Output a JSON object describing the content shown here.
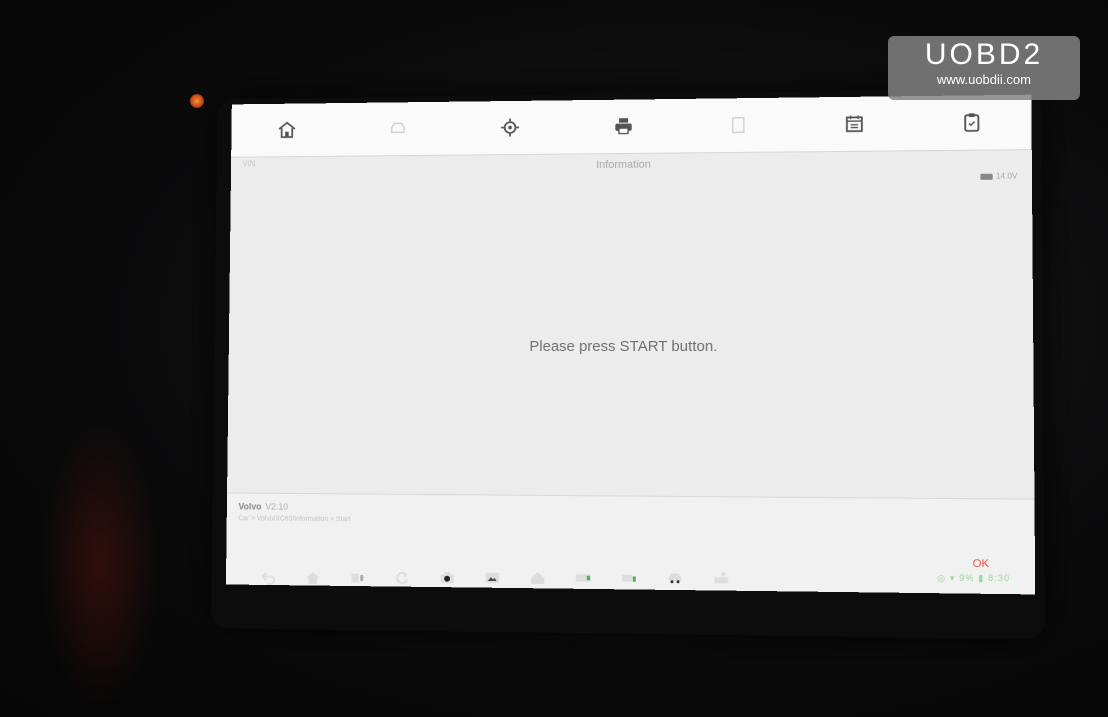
{
  "toolbar": {
    "icons": [
      "home-icon",
      "vehicle-icon",
      "settings-icon",
      "print-icon",
      "help-icon",
      "calendar-icon",
      "clipboard-icon"
    ]
  },
  "header": {
    "vin": "VIN",
    "title": "Information",
    "battery": "14.0V"
  },
  "main": {
    "message": "Please press START button."
  },
  "footer": {
    "vehicle_name": "Volvo",
    "vehicle_version": "V2.10",
    "vehicle_path": "Car > Volvo/XC60/Information > Start",
    "ok_label": "OK"
  },
  "navbar": {
    "status_text": "◎ ▾ 9% ▮ 8:30"
  },
  "watermark": {
    "brand": "UOBD2",
    "url": "www.uobdii.com"
  },
  "colors": {
    "accent_red": "#e2564c",
    "screen_bg": "#ececec",
    "status_green": "#9ad99a"
  }
}
